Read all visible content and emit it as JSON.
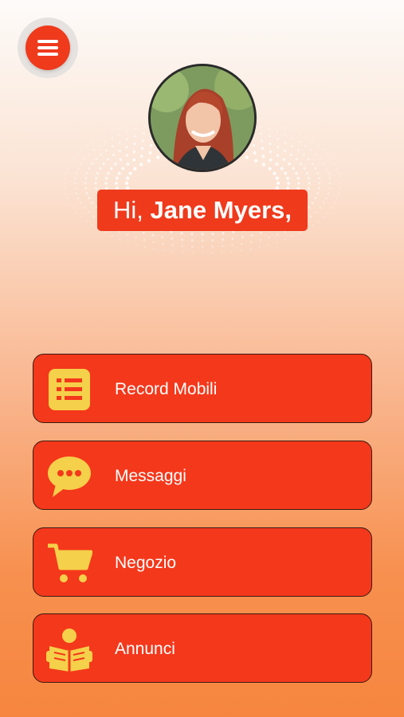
{
  "header": {
    "menu_icon": "hamburger-menu-icon",
    "avatar_alt": "Jane Myers profile photo"
  },
  "greeting": {
    "prefix": "Hi, ",
    "name": "Jane Myers,"
  },
  "nav": [
    {
      "label": "Record Mobili",
      "icon": "list-icon"
    },
    {
      "label": "Messaggi",
      "icon": "chat-bubble-icon"
    },
    {
      "label": "Negozio",
      "icon": "shopping-cart-icon"
    },
    {
      "label": "Annunci",
      "icon": "reader-book-icon"
    }
  ],
  "colors": {
    "accent": "#ef3a1c",
    "icon": "#f5d04a",
    "text": "#ffffff"
  }
}
